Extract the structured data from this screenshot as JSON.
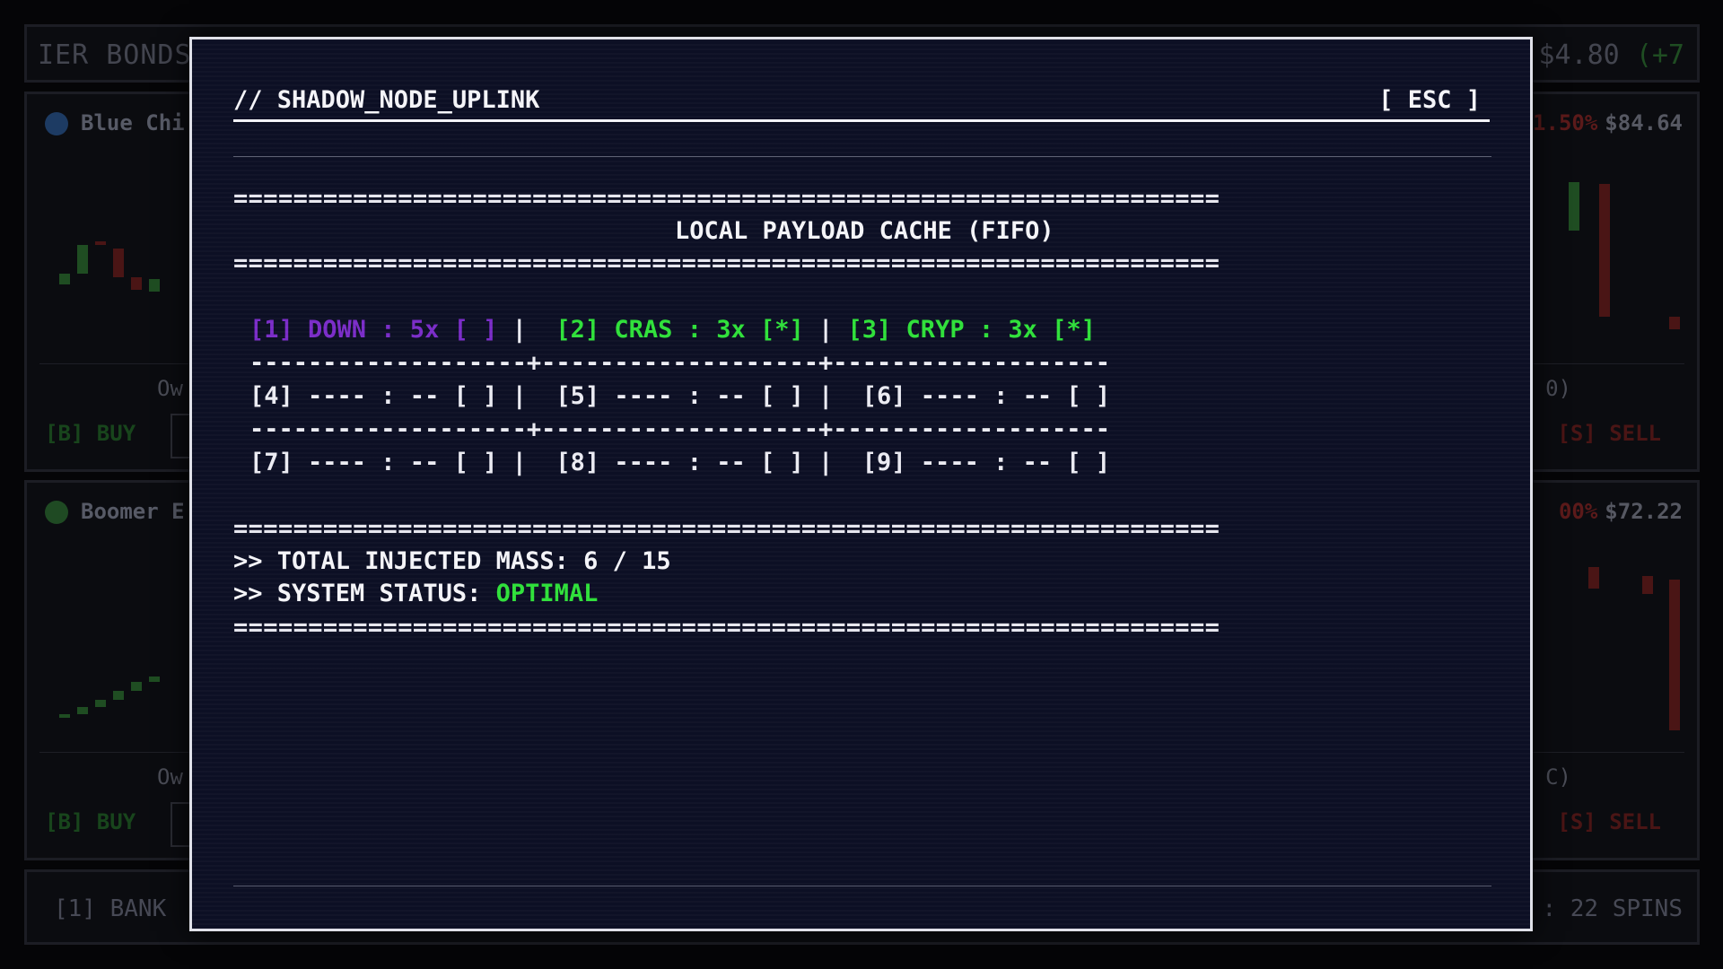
{
  "background": {
    "ticker": {
      "left": "IER BONDS",
      "right_value": "$4.80",
      "right_change": "(+7"
    },
    "stocks": [
      {
        "name": "Blue Chi",
        "change": "1.50%",
        "price": "$84.64",
        "owned_left": "Ow",
        "owned_right": "0)",
        "buy": "[B] BUY",
        "sell": "[S] SELL",
        "dot_color": "#1d3b63"
      },
      {
        "name": "Boomer E",
        "change": "00%",
        "price": "$72.22",
        "owned_left": "Ow",
        "owned_right": "C)",
        "buy": "[B] BUY",
        "sell": "[S] SELL",
        "dot_color": "#1f4a23"
      }
    ],
    "bottom": {
      "left": "[1] BANK",
      "right": ": 22 SPINS"
    }
  },
  "modal": {
    "title": "// SHADOW_NODE_UPLINK",
    "close_label": "[ ESC ]",
    "rule": "==================================================================",
    "heading": "LOCAL PAYLOAD CACHE (FIFO)",
    "grid_separator": "-------------------+-------------------+-------------------",
    "slots": [
      {
        "label": "[1] DOWN : 5x [ ]",
        "state": "purple"
      },
      {
        "label": "[2] CRAS : 3x [*]",
        "state": "green"
      },
      {
        "label": "[3] CRYP : 3x [*]",
        "state": "green"
      },
      {
        "label": "[4] ---- : -- [ ]",
        "state": "empty"
      },
      {
        "label": "[5] ---- : -- [ ]",
        "state": "empty"
      },
      {
        "label": "[6] ---- : -- [ ]",
        "state": "empty"
      },
      {
        "label": "[7] ---- : -- [ ]",
        "state": "empty"
      },
      {
        "label": "[8] ---- : -- [ ]",
        "state": "empty"
      },
      {
        "label": "[9] ---- : -- [ ]",
        "state": "empty"
      }
    ],
    "divider": "|",
    "mass_label": ">> TOTAL INJECTED MASS: 6 / 15",
    "status_label": ">> SYSTEM STATUS: ",
    "status_value": "OPTIMAL",
    "colors": {
      "purple": "#7a2cc8",
      "green": "#2fe03a",
      "text": "#ebebf2"
    }
  }
}
